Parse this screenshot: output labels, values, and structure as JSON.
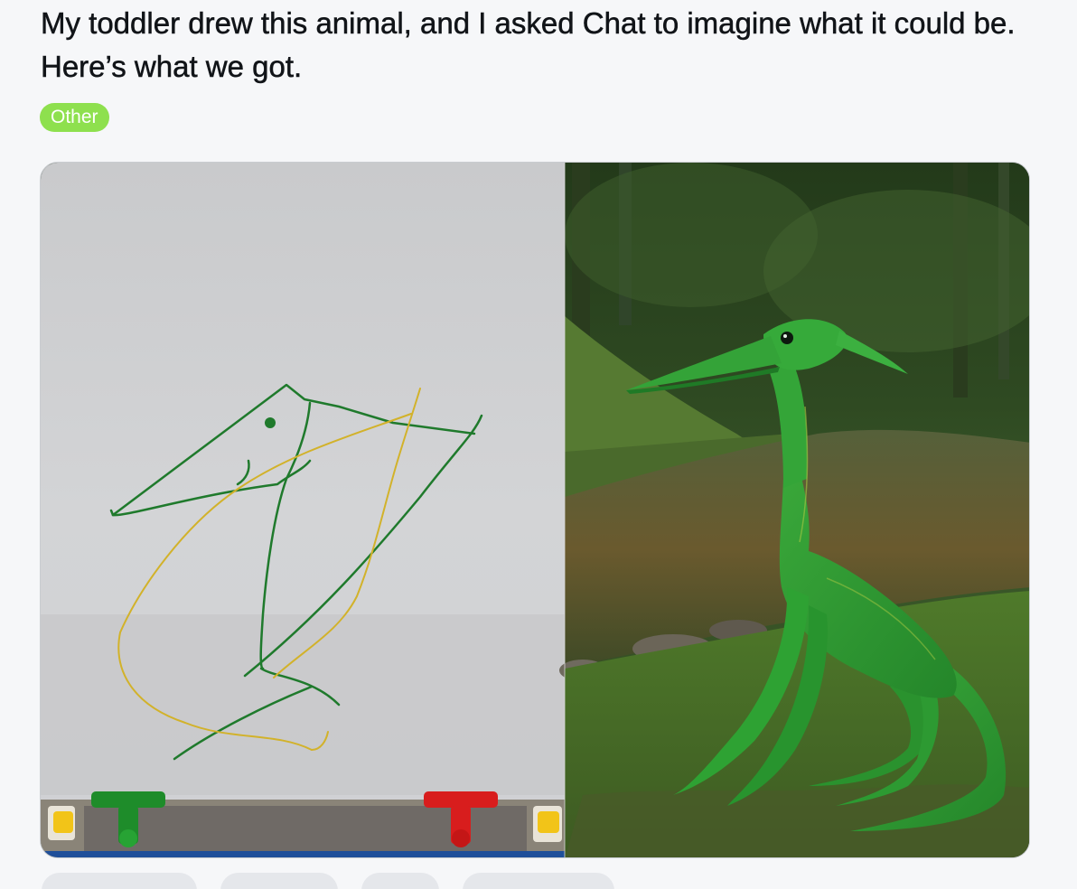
{
  "post": {
    "title": "My toddler drew this animal, and I asked Chat to imagine what it could be. Here’s what we got.",
    "flair": "Other",
    "flair_color": "#8ee04e"
  },
  "media": {
    "left_panel": "toddler-drawing-photo",
    "right_panel": "generated-creature-image"
  },
  "actions": [
    {
      "name": "upvote-action",
      "icon": "arrow-up-icon"
    },
    {
      "name": "comments-action",
      "icon": "comment-icon"
    },
    {
      "name": "award-action",
      "icon": "award-icon"
    },
    {
      "name": "share-action",
      "icon": "share-icon"
    }
  ]
}
